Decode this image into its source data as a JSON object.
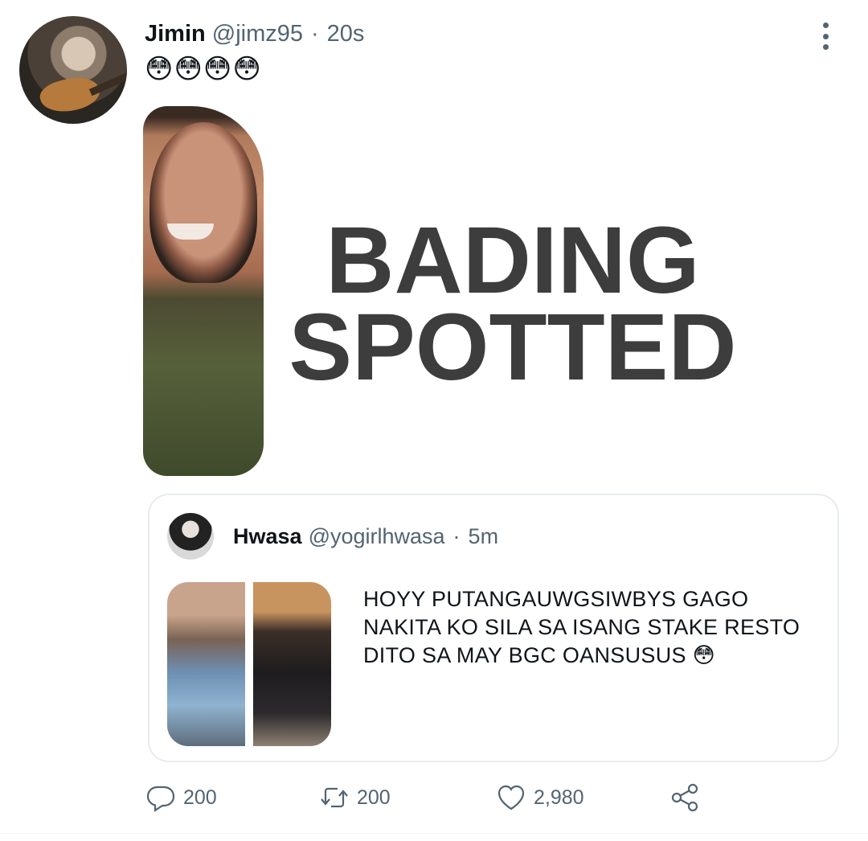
{
  "tweet": {
    "name": "Jimin",
    "handle": "@jimz95",
    "separator": "·",
    "time": "20s",
    "text": "😳😳😳😳",
    "media": {
      "line1": "BADING",
      "line2": "SPOTTED"
    }
  },
  "quoted": {
    "name": "Hwasa",
    "handle": "@yogirlhwasa",
    "separator": "·",
    "time": "5m",
    "text": "HOYY PUTANGAUWGSIWBYS GAGO NAKITA KO SILA SA ISANG STAKE RESTO DITO SA MAY BGC OANSUSUS 😳"
  },
  "actions": {
    "replies": "200",
    "retweets": "200",
    "likes": "2,980"
  },
  "colors": {
    "text": "#0f1419",
    "secondary": "#536471",
    "border": "#e6ebee",
    "meme_text": "#3d3d3d"
  },
  "icons": [
    "more-options-icon",
    "reply-icon",
    "retweet-icon",
    "like-icon",
    "share-icon"
  ]
}
